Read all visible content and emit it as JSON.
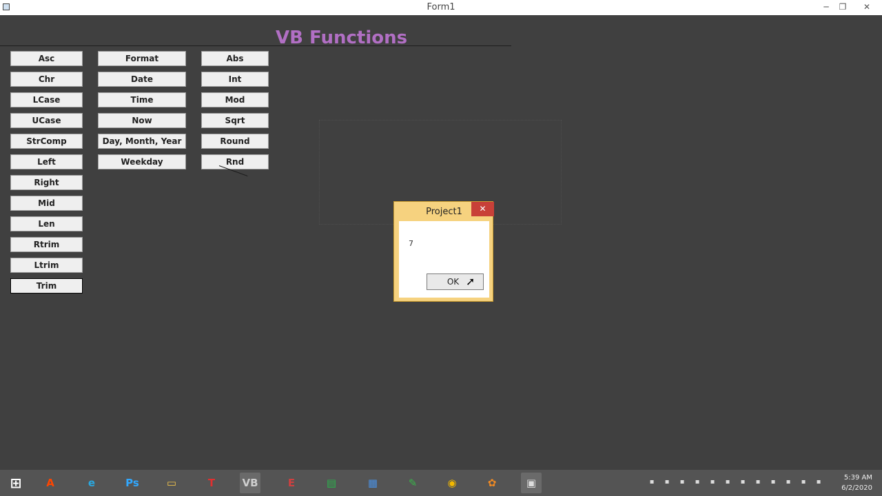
{
  "window": {
    "title": "Form1",
    "minimize": "─",
    "restore": "❐",
    "close": "✕"
  },
  "form": {
    "heading": "VB Functions",
    "col1": [
      "Asc",
      "Chr",
      "LCase",
      "UCase",
      "StrComp",
      "Left",
      "Right",
      "Mid",
      "Len",
      "Rtrim",
      "Ltrim",
      "Trim"
    ],
    "col2": [
      "Format",
      "Date",
      "Time",
      "Now",
      "Day, Month, Year",
      "Weekday"
    ],
    "col3": [
      "Abs",
      "Int",
      "Mod",
      "Sqrt",
      "Round",
      "Rnd"
    ],
    "focused_button": "Trim"
  },
  "msgbox": {
    "title": "Project1",
    "close": "✕",
    "message": "7",
    "ok_label": "OK"
  },
  "taskbar": {
    "start_glyph": "⊞",
    "apps": [
      {
        "icon": "adobe-a-icon",
        "glyph": "A",
        "color": "#ff4500"
      },
      {
        "icon": "internet-explorer-icon",
        "glyph": "e",
        "color": "#2aa8e0"
      },
      {
        "icon": "photoshop-icon",
        "glyph": "Ps",
        "color": "#31a8ff"
      },
      {
        "icon": "file-explorer-icon",
        "glyph": "▭",
        "color": "#f3c44c"
      },
      {
        "icon": "tally-icon",
        "glyph": "T",
        "color": "#e03030"
      },
      {
        "icon": "visual-basic-icon",
        "glyph": "VB",
        "color": "#cfcfcf"
      },
      {
        "icon": "tally-erp-icon",
        "glyph": "E",
        "color": "#d04040"
      },
      {
        "icon": "store-icon",
        "glyph": "▤",
        "color": "#2ab24b"
      },
      {
        "icon": "document-icon",
        "glyph": "▦",
        "color": "#4a8fe0"
      },
      {
        "icon": "green-app-icon",
        "glyph": "✎",
        "color": "#39b54a"
      },
      {
        "icon": "chrome-icon",
        "glyph": "◉",
        "color": "#f2b800"
      },
      {
        "icon": "paint-app-icon",
        "glyph": "✿",
        "color": "#f08a24"
      },
      {
        "icon": "screen-recorder-icon",
        "glyph": "▣",
        "color": "#dddddd"
      }
    ],
    "active_apps": [
      "visual-basic-icon",
      "screen-recorder-icon"
    ],
    "time": "5:39 AM",
    "date": "6/2/2020"
  }
}
